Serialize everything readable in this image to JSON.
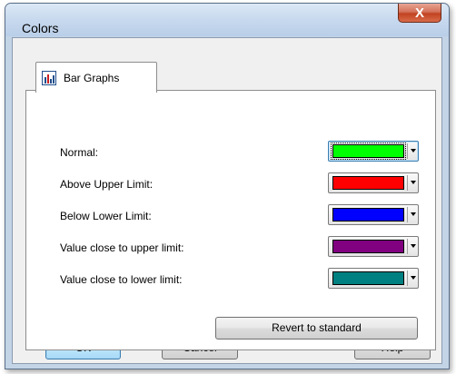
{
  "window": {
    "title": "Colors",
    "close_label": "X"
  },
  "tabs": [
    {
      "label": "Bar Graphs",
      "icon": "bar-chart-icon",
      "selected": true
    }
  ],
  "color_rows": [
    {
      "label": "Normal:",
      "color": "#00ff00",
      "focused": true
    },
    {
      "label": "Above Upper Limit:",
      "color": "#ff0000",
      "focused": false
    },
    {
      "label": "Below Lower Limit:",
      "color": "#0000ff",
      "focused": false
    },
    {
      "label": "Value close to upper limit:",
      "color": "#800080",
      "focused": false
    },
    {
      "label": "Value close to lower limit:",
      "color": "#008080",
      "focused": false
    }
  ],
  "buttons": {
    "revert": "Revert to standard",
    "ok": "OK",
    "cancel": "Cancel",
    "help": "Help"
  }
}
